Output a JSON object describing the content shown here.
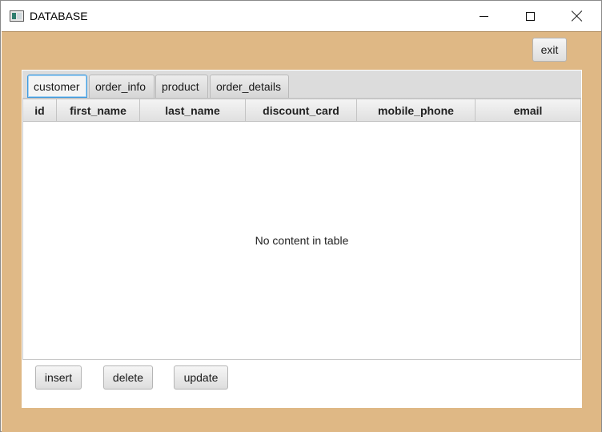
{
  "window": {
    "title": "DATABASE",
    "app_icon": "app-icon",
    "controls": [
      "minimize-icon",
      "maximize-icon",
      "close-icon"
    ]
  },
  "toolbar": {
    "exit_label": "exit"
  },
  "tabs": [
    {
      "label": "customer",
      "active": true
    },
    {
      "label": "order_info",
      "active": false
    },
    {
      "label": "product",
      "active": false
    },
    {
      "label": "order_details",
      "active": false
    }
  ],
  "table": {
    "columns": [
      "id",
      "first_name",
      "last_name",
      "discount_card",
      "mobile_phone",
      "email"
    ],
    "rows": [],
    "placeholder": "No content in table"
  },
  "actions": {
    "insert_label": "insert",
    "delete_label": "delete",
    "update_label": "update"
  },
  "colors": {
    "background": "#dfb885",
    "active_tab_border": "#3d9be0"
  }
}
